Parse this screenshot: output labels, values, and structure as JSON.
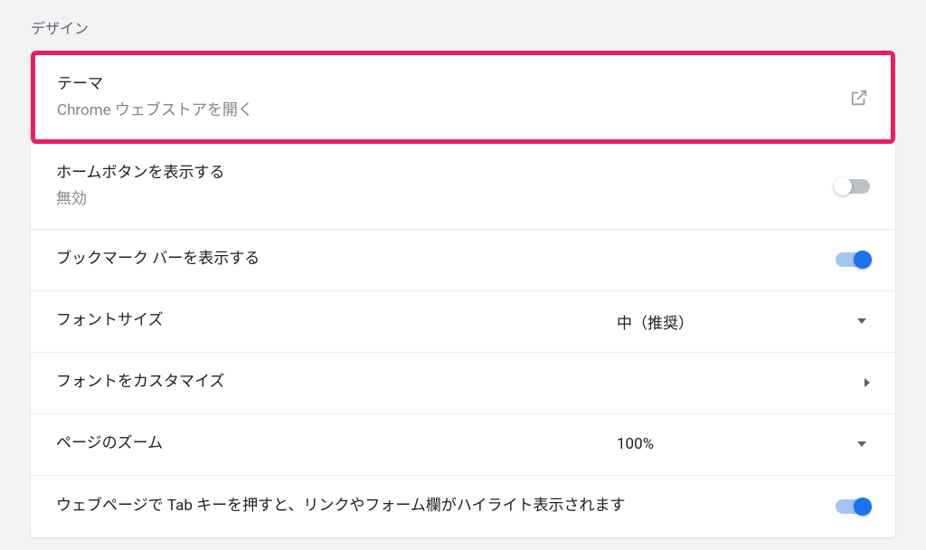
{
  "section": {
    "label": "デザイン"
  },
  "rows": {
    "theme": {
      "title": "テーマ",
      "sub": "Chrome ウェブストアを開く"
    },
    "home_button": {
      "title": "ホームボタンを表示する",
      "sub": "無効",
      "enabled": false
    },
    "bookmark_bar": {
      "title": "ブックマーク バーを表示する",
      "enabled": true
    },
    "font_size": {
      "title": "フォントサイズ",
      "value": "中（推奨）"
    },
    "font_custom": {
      "title": "フォントをカスタマイズ"
    },
    "page_zoom": {
      "title": "ページのズーム",
      "value": "100%"
    },
    "tab_highlight": {
      "title": "ウェブページで Tab キーを押すと、リンクやフォーム欄がハイライト表示されます",
      "enabled": true
    }
  }
}
